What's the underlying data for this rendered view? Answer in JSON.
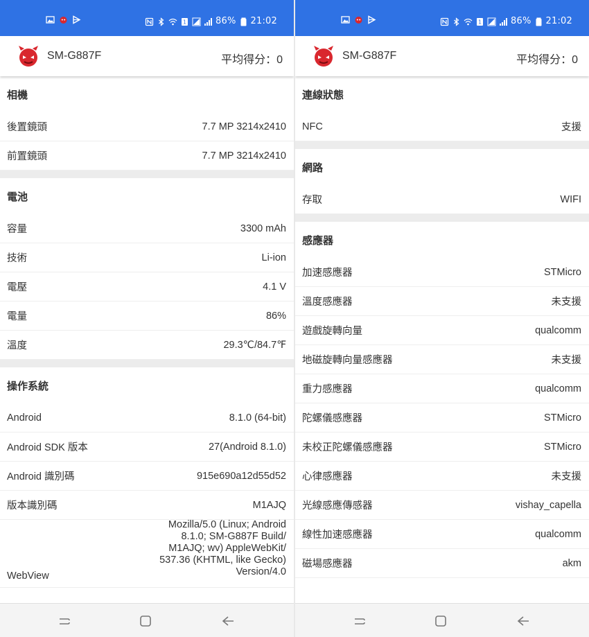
{
  "status_bar": {
    "battery_percent": "86%",
    "time": "21:02",
    "color": "#2f72e4"
  },
  "app_bar": {
    "device": "SM-G887F",
    "score_label": "平均得分：",
    "score_value": "0"
  },
  "left": {
    "sections": [
      {
        "title": "相機",
        "rows": [
          {
            "key": "後置鏡頭",
            "value": "7.7 MP 3214x2410"
          },
          {
            "key": "前置鏡頭",
            "value": "7.7 MP 3214x2410"
          }
        ]
      },
      {
        "title": "電池",
        "rows": [
          {
            "key": "容量",
            "value": "3300 mAh"
          },
          {
            "key": "技術",
            "value": "Li-ion"
          },
          {
            "key": "電壓",
            "value": "4.1 V"
          },
          {
            "key": "電量",
            "value": "86%"
          },
          {
            "key": "溫度",
            "value": "29.3℃/84.7℉"
          }
        ]
      },
      {
        "title": "操作系統",
        "rows": [
          {
            "key": "Android",
            "value": "8.1.0 (64-bit)"
          },
          {
            "key": "Android SDK 版本",
            "value": "27(Android 8.1.0)"
          },
          {
            "key": "Android 識別碼",
            "value": "915e690a12d55d52"
          },
          {
            "key": "版本識別碼",
            "value": "M1AJQ"
          },
          {
            "key": "WebView",
            "value": "Mozilla/5.0 (Linux; Android 8.1.0; SM-G887F Build/ M1AJQ; wv) AppleWebKit/ 537.36 (KHTML, like Gecko) Version/4.0"
          }
        ]
      }
    ]
  },
  "right": {
    "sections": [
      {
        "title": "連線狀態",
        "rows": [
          {
            "key": "NFC",
            "value": "支援"
          }
        ]
      },
      {
        "title": "網路",
        "rows": [
          {
            "key": "存取",
            "value": "WIFI"
          }
        ]
      },
      {
        "title": "感應器",
        "rows": [
          {
            "key": "加速感應器",
            "value": "STMicro"
          },
          {
            "key": "溫度感應器",
            "value": "未支援"
          },
          {
            "key": "遊戲旋轉向量",
            "value": "qualcomm"
          },
          {
            "key": "地磁旋轉向量感應器",
            "value": "未支援"
          },
          {
            "key": "重力感應器",
            "value": "qualcomm"
          },
          {
            "key": "陀螺儀感應器",
            "value": "STMicro"
          },
          {
            "key": "未校正陀螺儀感應器",
            "value": "STMicro"
          },
          {
            "key": "心律感應器",
            "value": "未支援"
          },
          {
            "key": "光線感應傳感器",
            "value": "vishay_capella"
          },
          {
            "key": "線性加速感應器",
            "value": "qualcomm"
          },
          {
            "key": "磁場感應器",
            "value": "akm"
          }
        ]
      }
    ]
  },
  "icons": {
    "status_left": [
      "image-icon",
      "antutu-notification-icon",
      "play-store-icon"
    ],
    "status_right": [
      "nfc-icon",
      "bluetooth-icon",
      "wifi-icon",
      "sim-icon",
      "signal-icon",
      "battery-icon"
    ],
    "nav": [
      "recent-apps-icon",
      "home-icon",
      "back-icon"
    ]
  }
}
